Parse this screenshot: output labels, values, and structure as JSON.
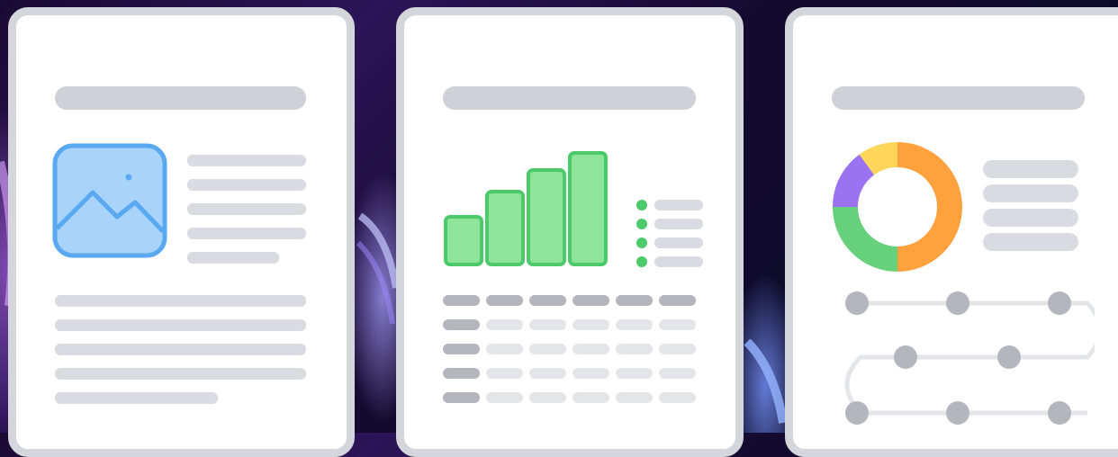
{
  "illustration": {
    "cards": [
      {
        "type": "image-document",
        "icon": "image-icon",
        "accent": "#5aa9f0"
      },
      {
        "type": "bar-chart-document",
        "icon": "bar-chart-icon",
        "accent": "#4cc96a"
      },
      {
        "type": "donut-chart-document",
        "icon": "donut-chart-icon",
        "segment_colors": [
          "#ffa13d",
          "#66d07a",
          "#9b72f2",
          "#ffd659"
        ]
      }
    ],
    "colors": {
      "card_border": "#d4d6db",
      "placeholder": "#d9dbe0",
      "node": "#b3b6bc"
    }
  }
}
